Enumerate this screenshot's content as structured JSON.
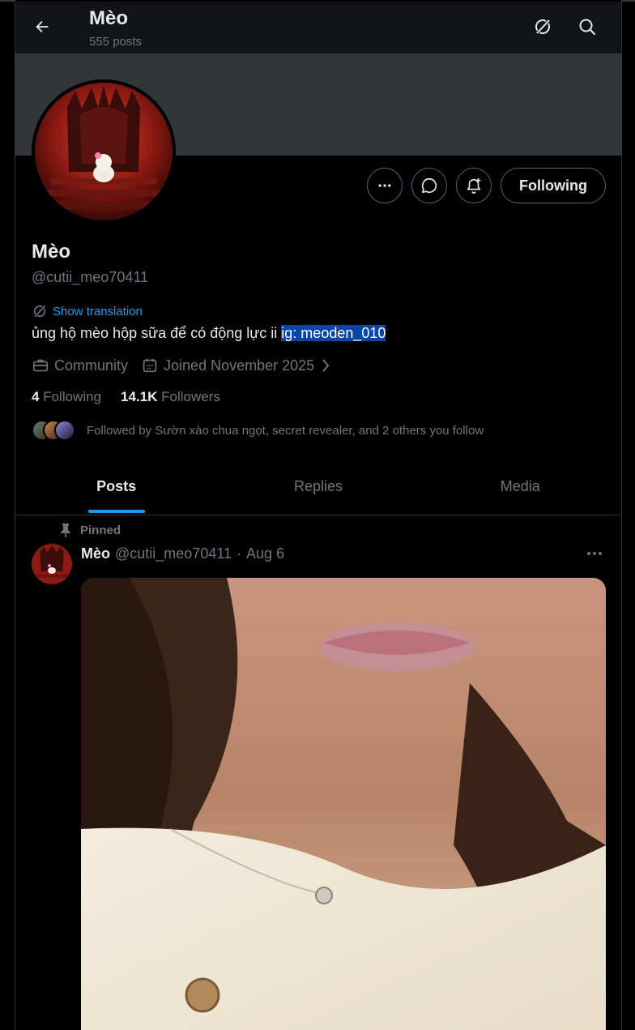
{
  "header": {
    "title": "Mèo",
    "posts_count": "555 posts"
  },
  "profile": {
    "name": "Mèo",
    "handle": "@cutii_meo70411",
    "show_translation": "Show translation",
    "bio_text": "ủng hộ mèo hộp sữa để có động lực ii ",
    "bio_highlight": "ig: meoden_010",
    "category": "Community",
    "joined": "Joined November 2025",
    "following_count": "4",
    "following_label": "Following",
    "followers_count": "14.1K",
    "followers_label": "Followers",
    "followed_by": "Followed by Sườn xào chua ngọt, secret revealer, and 2 others you follow",
    "follow_button": "Following"
  },
  "tabs": [
    {
      "label": "Posts",
      "active": true
    },
    {
      "label": "Replies",
      "active": false
    },
    {
      "label": "Media",
      "active": false
    }
  ],
  "post": {
    "pinned_label": "Pinned",
    "author_name": "Mèo",
    "author_handle": "@cutii_meo70411",
    "separator": "·",
    "date": "Aug 6"
  },
  "icons": {
    "back": "arrow-left-icon",
    "grok": "grok-icon",
    "search": "search-icon",
    "more": "more-icon",
    "message": "message-icon",
    "notify": "bell-plus-icon",
    "translate": "translate-icon",
    "category": "briefcase-icon",
    "calendar": "calendar-icon",
    "pin": "pin-icon"
  },
  "colors": {
    "accent": "#1d9bf0",
    "highlight": "#0a46a8",
    "muted": "#71767b",
    "text": "#e7e9ea"
  }
}
